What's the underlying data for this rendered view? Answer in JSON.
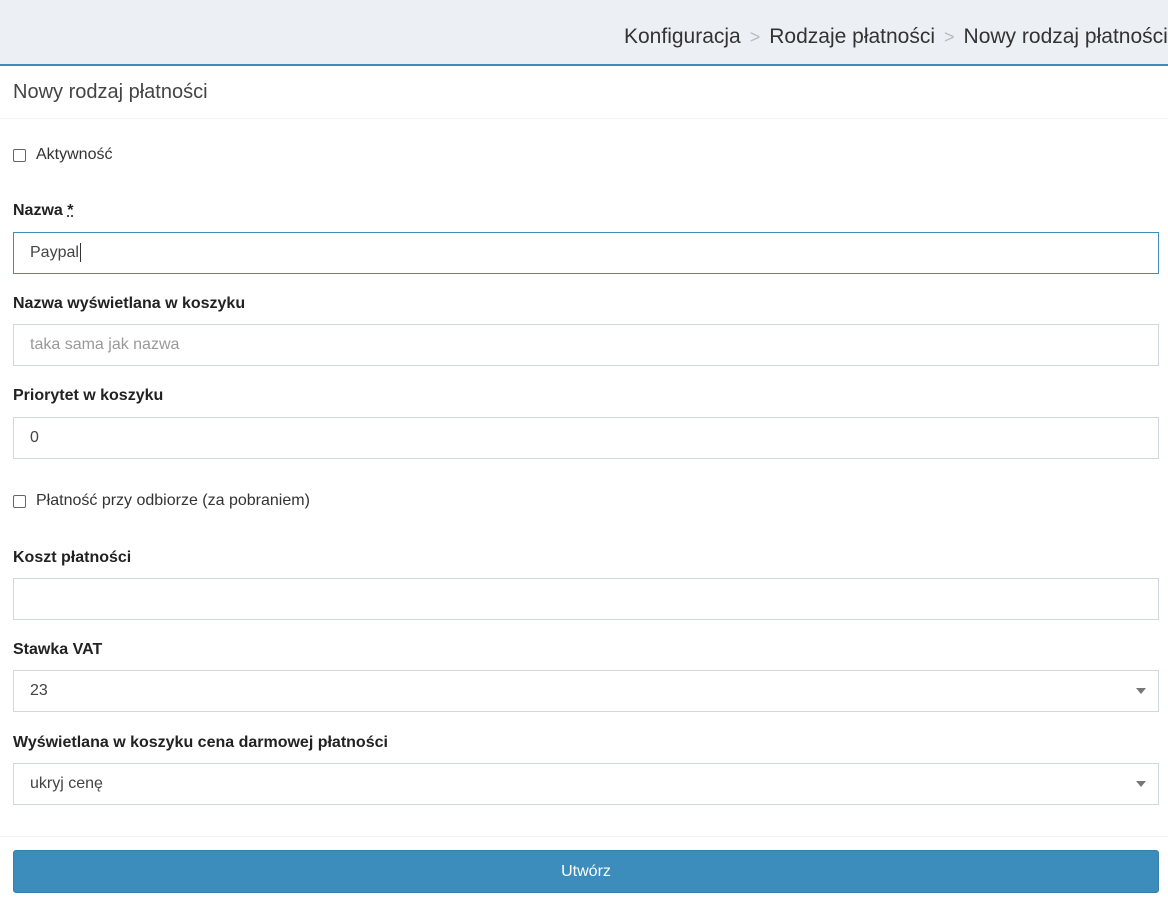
{
  "breadcrumb": {
    "items": [
      "Konfiguracja",
      "Rodzaje płatności",
      "Nowy rodzaj płatności"
    ],
    "separator": ">"
  },
  "panel": {
    "title": "Nowy rodzaj płatności"
  },
  "form": {
    "active_checkbox": {
      "label": "Aktywność",
      "checked": false
    },
    "name": {
      "label": "Nazwa",
      "required_mark": "*",
      "value": "Paypal"
    },
    "cart_name": {
      "label": "Nazwa wyświetlana w koszyku",
      "placeholder": "taka sama jak nazwa",
      "value": ""
    },
    "cart_priority": {
      "label": "Priorytet w koszyku",
      "value": "0"
    },
    "cod_checkbox": {
      "label": "Płatność przy odbiorze (za pobraniem)",
      "checked": false
    },
    "payment_cost": {
      "label": "Koszt płatności",
      "value": ""
    },
    "vat_rate": {
      "label": "Stawka VAT",
      "selected": "23"
    },
    "free_price_display": {
      "label": "Wyświetlana w koszyku cena darmowej płatności",
      "selected": "ukryj cenę"
    },
    "submit_label": "Utwórz"
  },
  "colors": {
    "accent": "#3c8dbc",
    "topbar_bg": "#eceff4"
  }
}
